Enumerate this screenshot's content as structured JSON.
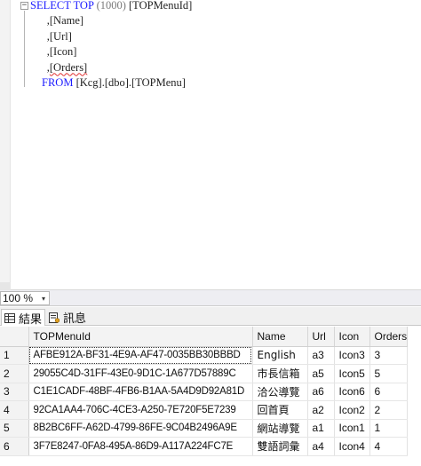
{
  "editor": {
    "collapse_glyph": "−",
    "lines": [
      {
        "kw1": "SELECT TOP",
        "grey": " (1000) ",
        "rest": "[TOPMenuId]"
      },
      {
        "text": "      ,[Name]"
      },
      {
        "text": "      ,[Url]"
      },
      {
        "text": "      ,[Icon]"
      },
      {
        "prefix": "      ,",
        "squiggle": "[Orders]"
      },
      {
        "kw1": "FROM",
        "rest": " [Kcg].[dbo].[TOPMenu]"
      }
    ]
  },
  "zoom": {
    "value": "100 %",
    "arrow": "▾"
  },
  "tabs": {
    "results_label": "結果",
    "messages_label": "訊息"
  },
  "grid": {
    "columns": [
      "",
      "TOPMenuId",
      "Name",
      "Url",
      "Icon",
      "Orders"
    ],
    "rows": [
      {
        "num": "1",
        "id": "AFBE912A-BF31-4E9A-AF47-0035BB30BBBD",
        "name": "English",
        "url": "a3",
        "icon": "Icon3",
        "orders": "3"
      },
      {
        "num": "2",
        "id": "29055C4D-31FF-43E0-9D1C-1A677D57889C",
        "name": "市長信箱",
        "url": "a5",
        "icon": "Icon5",
        "orders": "5"
      },
      {
        "num": "3",
        "id": "C1E1CADF-48BF-4FB6-B1AA-5A4D9D92A81D",
        "name": "洽公導覽",
        "url": "a6",
        "icon": "Icon6",
        "orders": "6"
      },
      {
        "num": "4",
        "id": "92CA1AA4-706C-4CE3-A250-7E720F5E7239",
        "name": "回首頁",
        "url": "a2",
        "icon": "Icon2",
        "orders": "2"
      },
      {
        "num": "5",
        "id": "8B2BC6FF-A62D-4799-86FE-9C04B2496A9E",
        "name": "網站導覽",
        "url": "a1",
        "icon": "Icon1",
        "orders": "1"
      },
      {
        "num": "6",
        "id": "3F7E8247-0FA8-495A-86D9-A117A224FC7E",
        "name": "雙語詞彙",
        "url": "a4",
        "icon": "Icon4",
        "orders": "4"
      }
    ]
  },
  "colors": {
    "keyword": "#1c1cff",
    "squiggle": "#e03030"
  }
}
